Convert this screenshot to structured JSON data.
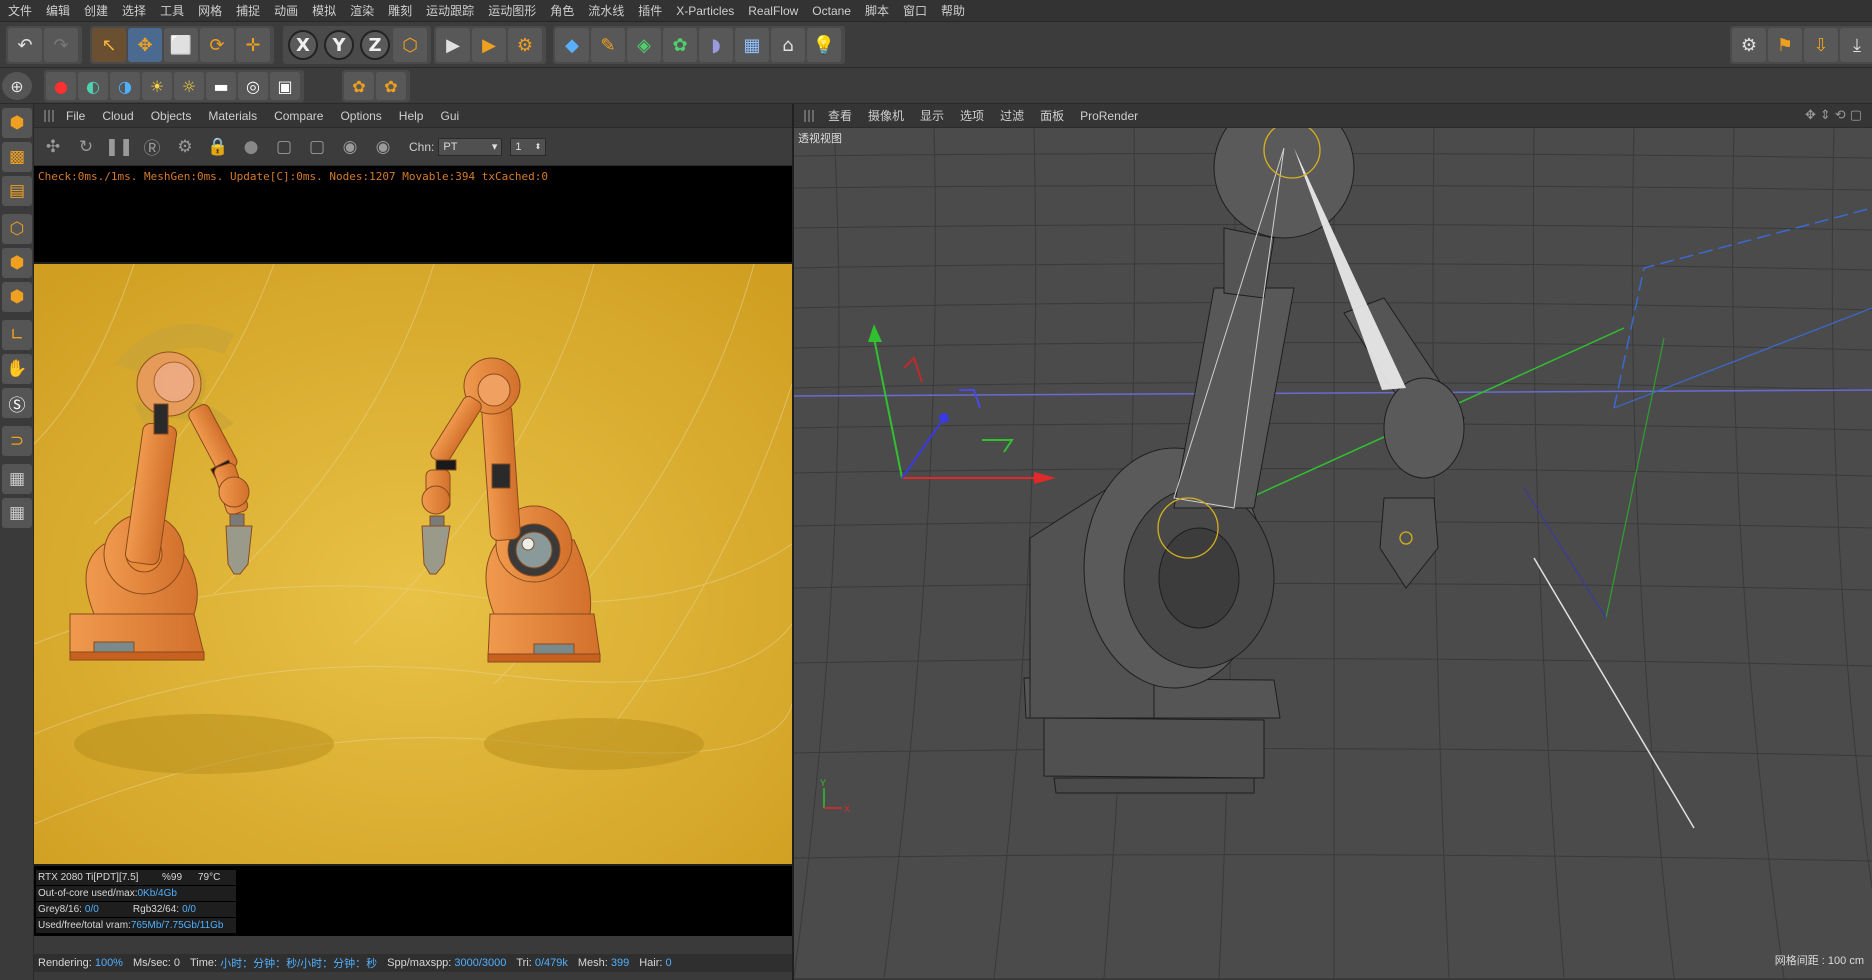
{
  "menubar": {
    "items": [
      "文件",
      "编辑",
      "创建",
      "选择",
      "工具",
      "网格",
      "捕捉",
      "动画",
      "模拟",
      "渲染",
      "雕刻",
      "运动跟踪",
      "运动图形",
      "角色",
      "流水线",
      "插件",
      "X-Particles",
      "RealFlow",
      "Octane",
      "脚本",
      "窗口",
      "帮助"
    ]
  },
  "toolbar": {
    "undo_icon": "↶",
    "redo_icon": "↷",
    "select_icon": "↖",
    "move_icon": "✥",
    "scale_icon": "⬜",
    "rotate_icon": "⟳",
    "transform_icon": "✛",
    "x_label": "X",
    "y_label": "Y",
    "z_label": "Z",
    "coord_icon": "⬡",
    "render_view_icon": "▶",
    "render_pv_icon": "▶",
    "render_settings_icon": "⚙",
    "cube_icon": "◆",
    "pen_icon": "✎",
    "subdiv_icon": "◈",
    "cloner_icon": "✿",
    "deformer_icon": "◗",
    "floor_icon": "▦",
    "camera_icon": "⌂",
    "light_icon": "💡",
    "right_icons": [
      "⚙",
      "⚑",
      "⇩",
      "⤓"
    ]
  },
  "octane_toolbar": {
    "icons": [
      "●",
      "◐",
      "◑",
      "☀",
      "☼",
      "▬",
      "◎",
      "▣",
      "✿",
      "✿"
    ]
  },
  "left_palette": {
    "icons": [
      "⬢",
      "▩",
      "▤",
      "⬡",
      "⬢",
      "⬢",
      "∟",
      "✋",
      "Ⓢ",
      "⊃",
      "▦",
      "▦"
    ]
  },
  "octane": {
    "menu": [
      "File",
      "Cloud",
      "Objects",
      "Materials",
      "Compare",
      "Options",
      "Help",
      "Gui"
    ],
    "tools": [
      "✣",
      "↻",
      "❚❚",
      "Ⓡ",
      "⚙",
      "🔒",
      "●",
      "▢",
      "▢",
      "◉",
      "◉"
    ],
    "chn_label": "Chn:",
    "chn_value": "PT",
    "spin_value": "1",
    "log": "Check:0ms./1ms. MeshGen:0ms. Update[C]:0ms. Nodes:1207 Movable:394 txCached:0",
    "stats": {
      "gpu": "RTX 2080 Ti[PDT][7.5]",
      "gpu_pct": "%99",
      "gpu_temp": "79°C",
      "outofcore_label": "Out-of-core used/max:",
      "outofcore_value": "0Kb/4Gb",
      "grey_label": "Grey8/16:",
      "grey_value": "0/0",
      "rgb_label": "Rgb32/64:",
      "rgb_value": "0/0",
      "vram_label": "Used/free/total vram:",
      "vram_value": "765Mb/7.75Gb/11Gb"
    },
    "status": {
      "rendering_label": "Rendering:",
      "rendering_value": "100%",
      "mssec_label": "Ms/sec:",
      "mssec_value": "0",
      "time_label": "Time:",
      "time_value": "小时：分钟：秒/小时：分钟：秒",
      "spp_label": "Spp/maxspp:",
      "spp_value": "3000/3000",
      "tri_label": "Tri:",
      "tri_value": "0/479k",
      "mesh_label": "Mesh:",
      "mesh_value": "399",
      "hair_label": "Hair:",
      "hair_value": "0"
    }
  },
  "viewport": {
    "menu": [
      "查看",
      "摄像机",
      "显示",
      "选项",
      "过滤",
      "面板",
      "ProRender"
    ],
    "nav_icons": [
      "✥",
      "⇕",
      "⟲",
      "▢"
    ],
    "title": "透视视图",
    "grid_label": "网格间距 : 100 cm",
    "axis_x": "X",
    "axis_y": "Y"
  },
  "colors": {
    "render_bg": "#d9ae2e",
    "robot_orange": "#e0843a",
    "accent_orange": "#f0a020",
    "log_orange": "#d47a2c",
    "stat_blue": "#4fb0ff"
  }
}
